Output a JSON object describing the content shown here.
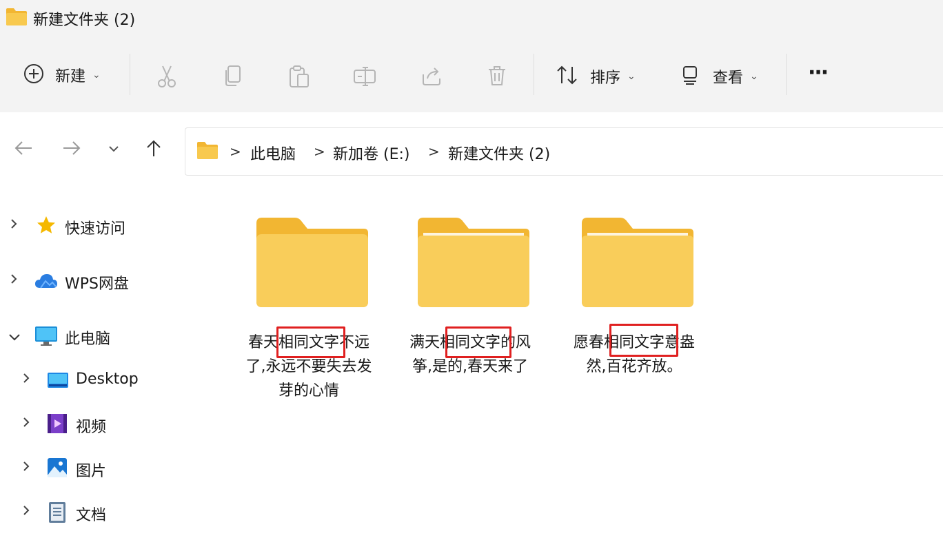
{
  "window": {
    "title": "新建文件夹 (2)"
  },
  "toolbar": {
    "new_label": "新建",
    "sort_label": "排序",
    "view_label": "查看",
    "more_label": "···",
    "icons": [
      "plus-circle-icon",
      "cut-icon",
      "copy-icon",
      "paste-icon",
      "rename-icon",
      "share-icon",
      "delete-icon",
      "sort-icon",
      "view-icon"
    ]
  },
  "address": {
    "crumbs": [
      "此电脑",
      "新加卷 (E:)",
      "新建文件夹 (2)"
    ],
    "separator": ">"
  },
  "sidebar": {
    "items": [
      {
        "label": "快速访问",
        "icon": "star-icon",
        "expanded": false
      },
      {
        "label": "WPS网盘",
        "icon": "cloud-icon",
        "expanded": false
      },
      {
        "label": "此电脑",
        "icon": "monitor-icon",
        "expanded": true
      },
      {
        "label": "Desktop",
        "icon": "desktop-icon",
        "expanded": false
      },
      {
        "label": "视频",
        "icon": "video-icon",
        "expanded": false
      },
      {
        "label": "图片",
        "icon": "picture-icon",
        "expanded": false
      },
      {
        "label": "文档",
        "icon": "document-icon",
        "expanded": false
      }
    ]
  },
  "folders": [
    {
      "name": "春天相同文字不远了,永远不要失去发芽的心情"
    },
    {
      "name": "满天相同文字的风筝,是的,春天来了"
    },
    {
      "name": "愿春相同文字意盎然,百花齐放。"
    }
  ],
  "colors": {
    "highlight": "#e02020",
    "folder": "#f8c94e",
    "folder_tab": "#f2b632"
  }
}
